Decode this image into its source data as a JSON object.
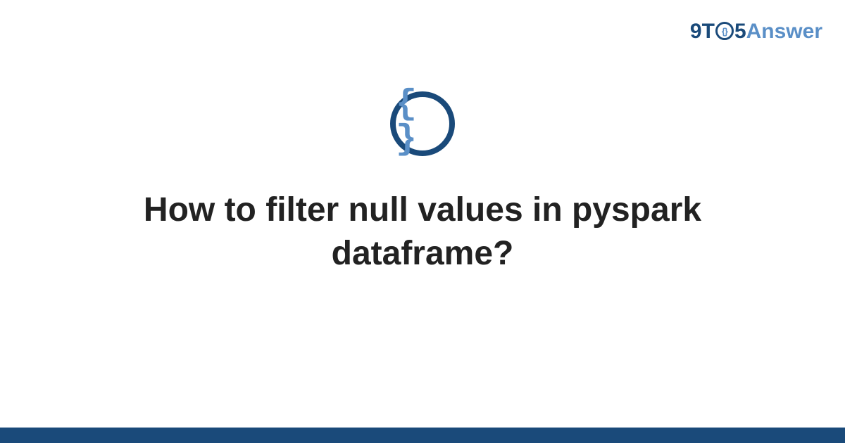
{
  "logo": {
    "part1": "9T",
    "ring_inner": "{}",
    "part2": "5",
    "part3": "Answer"
  },
  "icon": {
    "braces": "{ }"
  },
  "title": "How to filter null values in pyspark dataframe?"
}
